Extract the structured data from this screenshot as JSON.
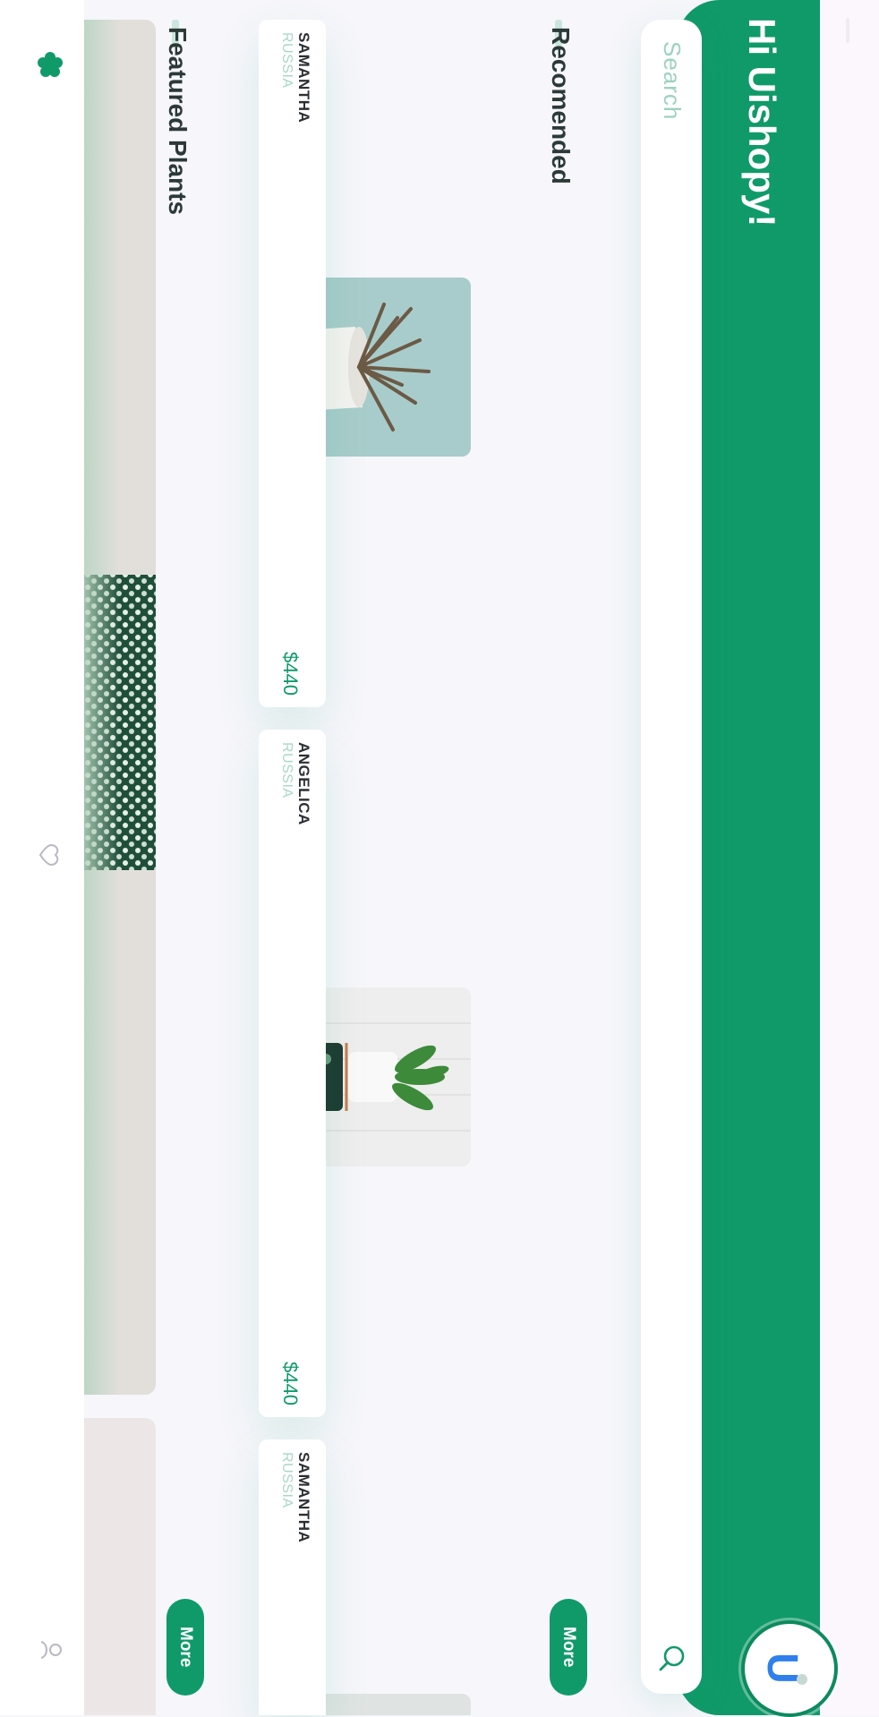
{
  "header": {
    "greeting": "Hi Uishopy!",
    "avatar_letter": "U",
    "accent_color": "#109a69"
  },
  "search": {
    "placeholder": "Search",
    "icon": "search-icon"
  },
  "recommended": {
    "title": "Recomended",
    "more_label": "More",
    "cards": [
      {
        "name": "SAMANTHA",
        "country": "RUSSIA",
        "price": "$440",
        "image": "aloe-in-white-pot"
      },
      {
        "name": "ANGELICA",
        "country": "RUSSIA",
        "price": "$440",
        "image": "plant-in-floral-vase"
      },
      {
        "name": "SAMANTHA",
        "country": "RUSSIA",
        "price": "",
        "image": ""
      }
    ]
  },
  "featured": {
    "title": "Featured Plants",
    "more_label": "More"
  },
  "nav": {
    "items": [
      "plant-icon",
      "heart-icon",
      "user-icon"
    ]
  }
}
